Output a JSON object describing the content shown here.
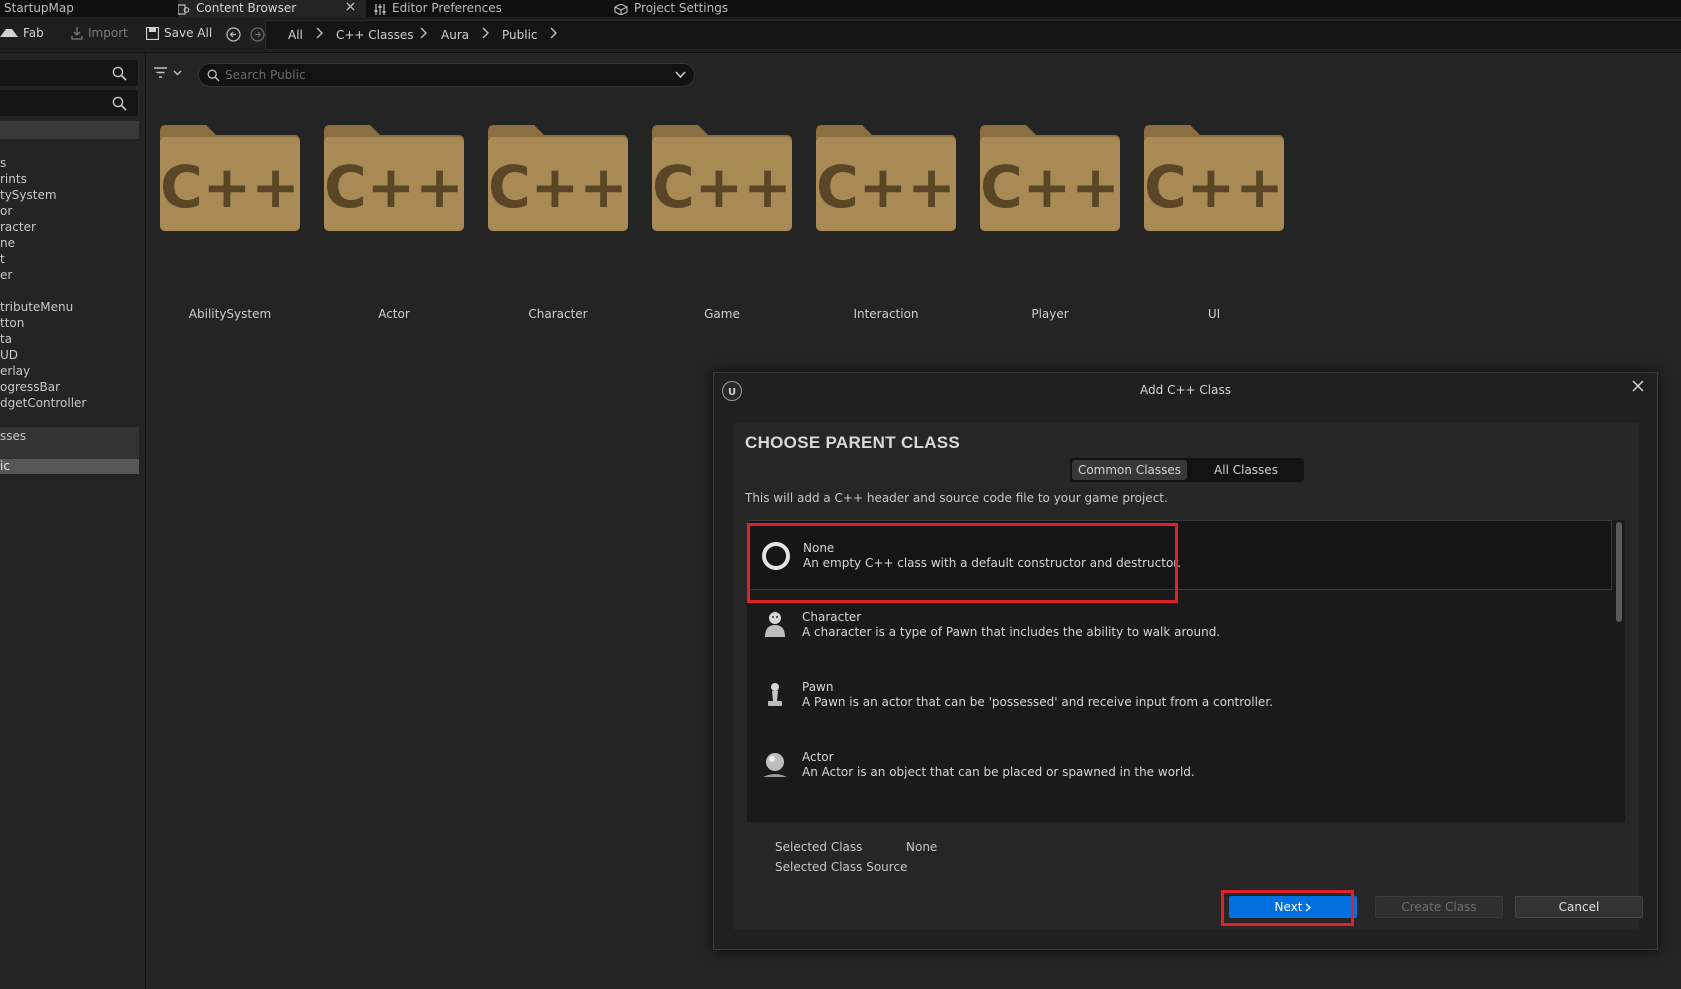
{
  "tabs": [
    {
      "label": "StartupMap",
      "active": false
    },
    {
      "label": "Content Browser",
      "active": true
    },
    {
      "label": "Editor Preferences",
      "active": false
    },
    {
      "label": "Project Settings",
      "active": false
    }
  ],
  "toolbar": {
    "fab": "Fab",
    "import": "Import",
    "save_all": "Save All",
    "breadcrumb": [
      "All",
      "C++ Classes",
      "Aura",
      "Public"
    ]
  },
  "sidebar": {
    "items": [
      "s",
      "rints",
      "tySystem",
      "or",
      "racter",
      "ne",
      "t",
      "er",
      "tributeMenu",
      "tton",
      "ta",
      "UD",
      "erlay",
      "ogressBar",
      "dgetController",
      "sses",
      "ic"
    ]
  },
  "search": {
    "placeholder": "Search Public"
  },
  "folders": [
    {
      "label": "AbilitySystem",
      "icon_text": "C++"
    },
    {
      "label": "Actor",
      "icon_text": "C++"
    },
    {
      "label": "Character",
      "icon_text": "C++"
    },
    {
      "label": "Game",
      "icon_text": "C++"
    },
    {
      "label": "Interaction",
      "icon_text": "C++"
    },
    {
      "label": "Player",
      "icon_text": "C++"
    },
    {
      "label": "UI",
      "icon_text": "C++"
    }
  ],
  "dialog": {
    "title": "Add C++ Class",
    "heading": "CHOOSE PARENT CLASS",
    "tabs": [
      "Common Classes",
      "All Classes"
    ],
    "description": "This will add a C++ header and source code file to your game project.",
    "classes": [
      {
        "name": "None",
        "desc": "An empty C++ class with a default constructor and destructor.",
        "icon": "empty-circle-icon"
      },
      {
        "name": "Character",
        "desc": "A character is a type of Pawn that includes the ability to walk around.",
        "icon": "character-icon"
      },
      {
        "name": "Pawn",
        "desc": "A Pawn is an actor that can be 'possessed' and receive input from a controller.",
        "icon": "pawn-icon"
      },
      {
        "name": "Actor",
        "desc": "An Actor is an object that can be placed or spawned in the world.",
        "icon": "actor-icon"
      }
    ],
    "selected_class_label": "Selected Class",
    "selected_class_value": "None",
    "selected_source_label": "Selected Class Source",
    "next": "Next",
    "create": "Create Class",
    "cancel": "Cancel"
  },
  "colors": {
    "accent": "#0070e0",
    "highlight": "#e0202a",
    "folder": "#a88a55"
  }
}
